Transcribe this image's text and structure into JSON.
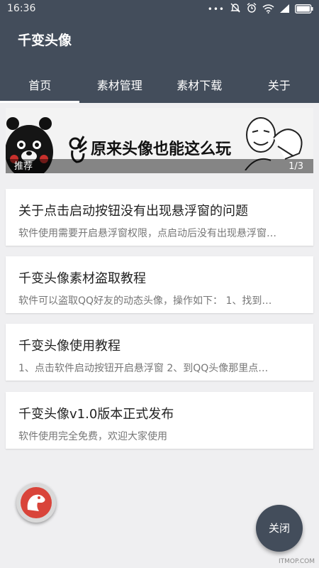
{
  "status_bar": {
    "time": "16:36",
    "dots": "•••"
  },
  "app": {
    "title": "千变头像"
  },
  "tabs": [
    {
      "label": "首页",
      "active": true
    },
    {
      "label": "素材管理"
    },
    {
      "label": "素材下载"
    },
    {
      "label": "关于"
    }
  ],
  "banner": {
    "text": "原来头像也能这么玩",
    "tag": "推荐",
    "index": "1/3"
  },
  "articles": [
    {
      "title": "关于点击启动按钮没有出现悬浮窗的问题",
      "desc": "软件使用需要开启悬浮窗权限，点启动后没有出现悬浮窗…"
    },
    {
      "title": "千变头像素材盗取教程",
      "desc": "软件可以盗取QQ好友的动态头像，操作如下：  1、找到…"
    },
    {
      "title": "千变头像使用教程",
      "desc": "1、点击软件启动按钮开启悬浮窗 2、到QQ头像那里点…"
    },
    {
      "title": "千变头像v1.0版本正式发布",
      "desc": "软件使用完全免费，欢迎大家使用"
    }
  ],
  "close_button": {
    "label": "关闭"
  },
  "watermark": "ITMOP.COM",
  "colors": {
    "header": "#434d5b",
    "background": "#efeff1",
    "float_button": "#d9443a"
  }
}
